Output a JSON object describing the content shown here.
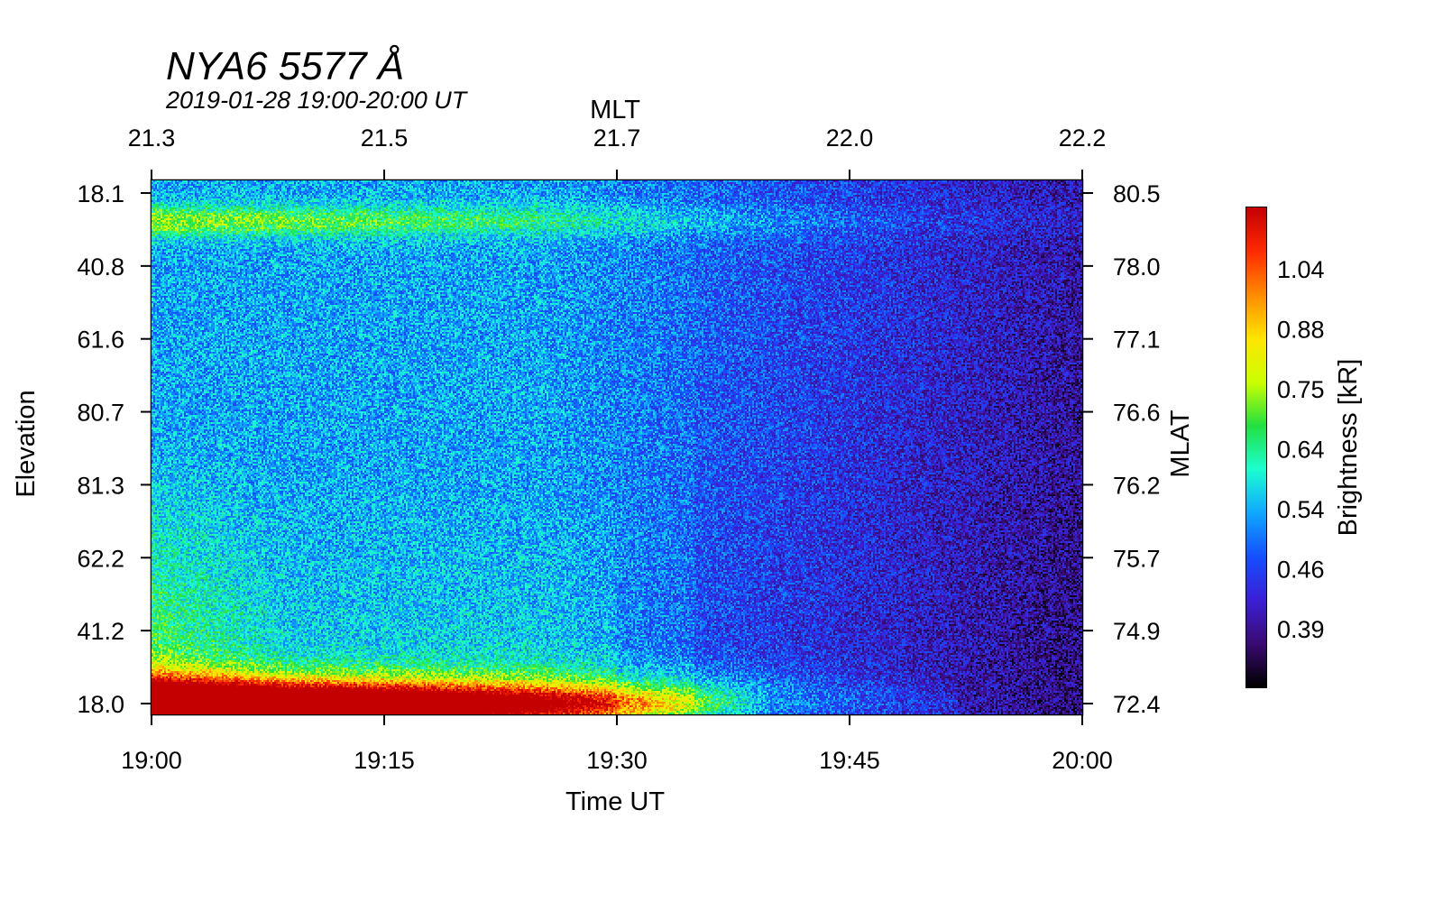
{
  "chart_data": {
    "type": "heatmap",
    "title": "NYA6 5577 Å",
    "subtitle": "2019-01-28 19:00-20:00 UT",
    "xlabel": "Time UT",
    "x_ticks": [
      "19:00",
      "19:15",
      "19:30",
      "19:45",
      "20:00"
    ],
    "x_range_minutes": [
      0,
      60
    ],
    "top_axis": {
      "label": "MLT",
      "ticks": [
        "21.3",
        "21.5",
        "21.7",
        "22.0",
        "22.2"
      ]
    },
    "ylabel": "Elevation",
    "y_ticks": [
      "18.1",
      "40.8",
      "61.6",
      "80.7",
      "81.3",
      "62.2",
      "41.2",
      "18.0"
    ],
    "right_axis": {
      "label": "MLAT",
      "ticks": [
        "80.5",
        "78.0",
        "77.1",
        "76.6",
        "76.2",
        "75.7",
        "74.9",
        "72.4"
      ]
    },
    "colorbar": {
      "label": "Brightness [kR]",
      "ticks": [
        "1.04",
        "0.88",
        "0.75",
        "0.64",
        "0.54",
        "0.46",
        "0.39"
      ],
      "colormap": [
        "#000000",
        "#3a0b73",
        "#3b1fd6",
        "#1450ff",
        "#10a8ff",
        "#1bffd0",
        "#22e040",
        "#ccff00",
        "#ffe600",
        "#ff8c00",
        "#ff2a00",
        "#c40000"
      ]
    },
    "features": [
      {
        "type": "band",
        "desc_y_frac": 0.08,
        "intensity": 0.6,
        "t_end": 45
      },
      {
        "type": "bright_bottom",
        "intensity": 1.1,
        "t_end": 38
      },
      {
        "type": "diffuse_patch",
        "t_start": 0,
        "t_end": 8,
        "intensity": 0.55
      }
    ]
  }
}
